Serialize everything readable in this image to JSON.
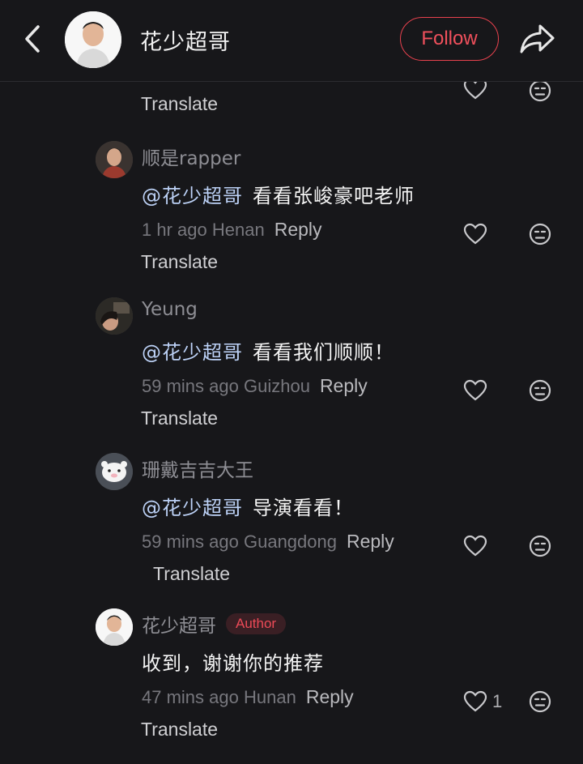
{
  "header": {
    "back_icon": "chevron-left-icon",
    "name": "花少超哥",
    "follow_label": "Follow",
    "share_icon": "share-arrow-icon",
    "accent_color": "#e8424e"
  },
  "partial_comment": {
    "translate_label": "Translate"
  },
  "comments": [
    {
      "username": "顺是rapper",
      "mention": "@花少超哥",
      "text": "看看张峻豪吧老师",
      "time": "1 hr ago",
      "location": "Henan",
      "reply_label": "Reply",
      "translate_label": "Translate",
      "likes": ""
    },
    {
      "username": "Yeung",
      "mention": "@花少超哥",
      "text": "看看我们顺顺！",
      "time": "59 mins ago",
      "location": "Guizhou",
      "reply_label": "Reply",
      "translate_label": "Translate",
      "likes": ""
    },
    {
      "username": "珊戴吉吉大王",
      "mention": "@花少超哥",
      "text": "导演看看！",
      "time": "59 mins ago",
      "location": "Guangdong",
      "reply_label": "Reply",
      "translate_label": "Translate",
      "likes": ""
    },
    {
      "username": "花少超哥",
      "badge": "Author",
      "mention": "",
      "text": "收到，谢谢你的推荐",
      "time": "47 mins ago",
      "location": "Hunan",
      "reply_label": "Reply",
      "translate_label": "Translate",
      "likes": "1"
    }
  ]
}
